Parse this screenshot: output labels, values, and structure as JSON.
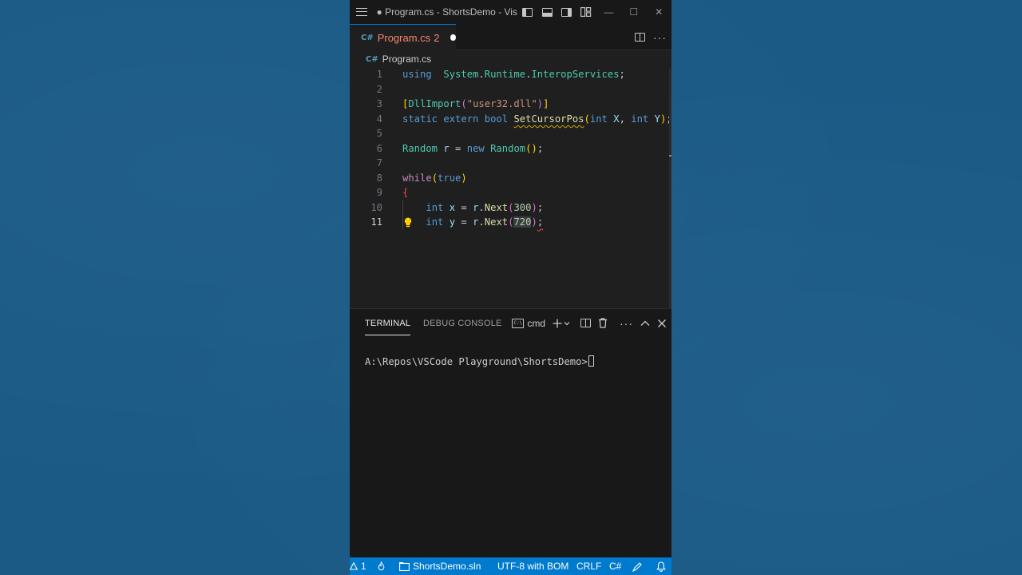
{
  "window": {
    "title": "● Program.cs - ShortsDemo - Vis..."
  },
  "tab": {
    "filename": "Program.cs",
    "problem_count": "2",
    "icon": "csharp-icon"
  },
  "breadcrumb": {
    "file": "Program.cs"
  },
  "editor": {
    "active_line": 11,
    "line_numbers": [
      "1",
      "2",
      "3",
      "4",
      "5",
      "6",
      "7",
      "8",
      "9",
      "10",
      "11"
    ]
  },
  "panel": {
    "tabs": [
      "TERMINAL",
      "DEBUG CONSOLE"
    ],
    "active_tab": "TERMINAL",
    "shell": "cmd",
    "terminal_prompt": "A:\\Repos\\VSCode Playground\\ShortsDemo>"
  },
  "statusbar": {
    "warnings": "1",
    "solution": "ShortsDemo.sln",
    "encoding": "UTF-8 with BOM",
    "eol": "CRLF",
    "language": "C#"
  },
  "colors": {
    "background": "#1a5a85",
    "editor_bg": "#1f1f1f",
    "statusbar": "#007acc",
    "tab_modified": "#f48771"
  }
}
